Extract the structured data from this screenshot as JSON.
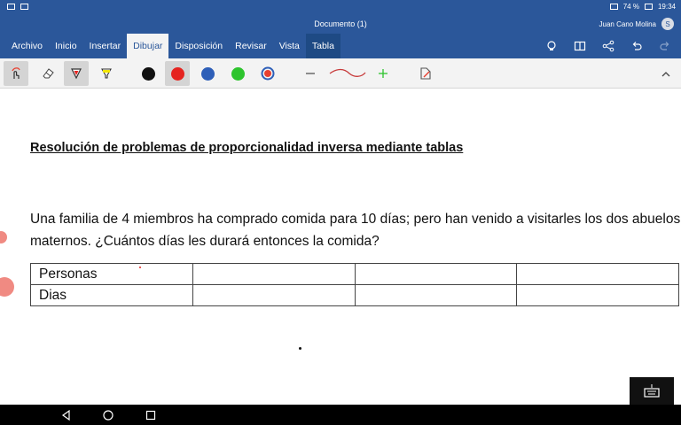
{
  "status": {
    "battery": "74 %",
    "time": "19:34"
  },
  "title": "Documento (1)",
  "user": {
    "name": "Juan Cano Molina",
    "initial": "S"
  },
  "tabs": [
    "Archivo",
    "Inicio",
    "Insertar",
    "Dibujar",
    "Disposición",
    "Revisar",
    "Vista",
    "Tabla"
  ],
  "active_tab": "Dibujar",
  "ribbon": {
    "tools": [
      "draw-with-touch-icon",
      "eraser-icon",
      "pen-icon",
      "highlighter-icon"
    ],
    "colors": [
      "#111111",
      "#e52420",
      "#2e5fb8",
      "#2ec42e",
      "#e84030"
    ],
    "line_color": "#c73a3a"
  },
  "doc": {
    "heading": "Resolución de problemas de proporcionalidad inversa mediante tablas",
    "paragraph": "Una familia de 4 miembros  ha comprado comida para  10 días; pero han venido a visitarles los dos abuelos maternos. ¿Cuántos días les durará entonces la comida?",
    "table": {
      "rows": [
        [
          "Personas",
          "",
          "",
          ""
        ],
        [
          "Dias",
          "",
          "",
          ""
        ]
      ]
    }
  }
}
